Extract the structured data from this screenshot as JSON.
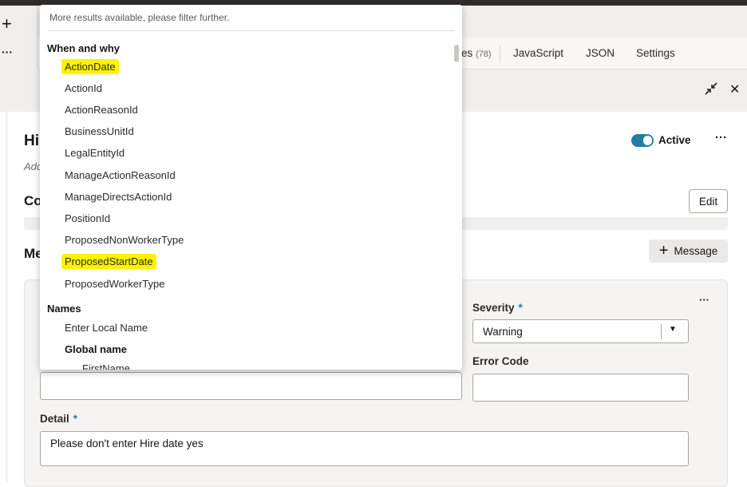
{
  "toolbar": {
    "add_label": "+",
    "more_label": "···"
  },
  "tabs": [
    {
      "label": "es",
      "count": "(78)"
    },
    {
      "label": "JavaScript"
    },
    {
      "label": "JSON"
    },
    {
      "label": "Settings"
    }
  ],
  "panel": {
    "collapse_icon": "collapse-icon",
    "close_label": "✕"
  },
  "rule": {
    "title": "Hi",
    "subtitle": "Add",
    "active_label": "Active",
    "active": true,
    "more_label": "···"
  },
  "conditions": {
    "heading": "Co",
    "edit_label": "Edit"
  },
  "messages": {
    "heading": "Me",
    "add_label": "Message"
  },
  "form": {
    "more_label": "···",
    "severity_label": "Severity",
    "severity_value": "Warning",
    "error_code_label": "Error Code",
    "error_code_value": "",
    "detail_label": "Detail",
    "detail_value": "Please don't enter Hire date yes",
    "required_mark": "*"
  },
  "dropdown": {
    "note": "More results available, please filter further.",
    "groups": [
      {
        "label": "When and why",
        "items": [
          "ActionDate",
          "ActionId",
          "ActionReasonId",
          "BusinessUnitId",
          "LegalEntityId",
          "ManageActionReasonId",
          "ManageDirectsActionId",
          "PositionId",
          "ProposedNonWorkerType",
          "ProposedStartDate",
          "ProposedWorkerType"
        ],
        "highlighted": [
          "ActionDate",
          "ProposedStartDate"
        ]
      },
      {
        "label": "Names",
        "items": [
          "Enter Local Name"
        ],
        "subgroup": "Global name",
        "subitems": [
          "FirstName"
        ]
      }
    ],
    "highlight_color": "#fff200"
  },
  "colors": {
    "accent": "#227e9e"
  }
}
